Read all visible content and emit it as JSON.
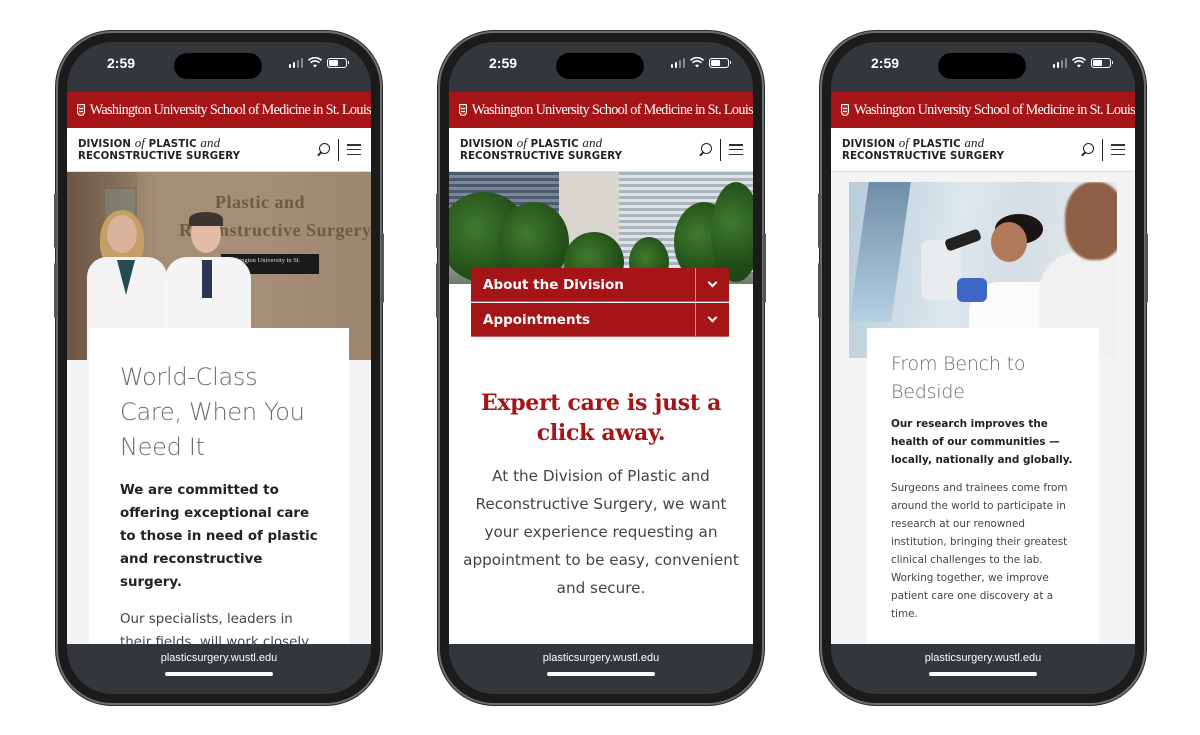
{
  "common": {
    "time": "2:59",
    "university_name": "Washington University School of Medicine in St. Louis",
    "division_line1_a": "DIVISION ",
    "division_line1_of": "of",
    "division_line1_b": " PLASTIC ",
    "division_line1_and": "and",
    "division_line2": "RECONSTRUCTIVE SURGERY",
    "url": "plasticsurgery.wustl.edu",
    "icons": [
      "search-icon",
      "menu-icon",
      "signal-icon",
      "wifi-icon",
      "battery-icon",
      "wustl-shield-icon"
    ],
    "brand_color": "#a51417"
  },
  "phone1": {
    "hero_sign_line1": "Plastic and",
    "hero_sign_line2": "Reconstructive Surgery",
    "hero_plaque": "Washington University in St. Louis",
    "heading": "World-Class Care, When You Need It",
    "lead": "We are committed to offering exceptional care to those in need of plastic and reconstructive surgery.",
    "body": "Our specialists, leaders in their fields, will work closely with all those involved in your health care to ensure a"
  },
  "phone2": {
    "accordion": [
      {
        "label": "About the Division"
      },
      {
        "label": "Appointments"
      }
    ],
    "cta_title": "Expert care is just a click away.",
    "cta_body": "At the Division of Plastic and Reconstructive Surgery, we want your experience requesting an appointment to be easy, convenient and secure."
  },
  "phone3": {
    "heading": "From Bench to Bedside",
    "lead": "Our research improves the health of our communities — locally, nationally and globally.",
    "body": "Surgeons and trainees come from around the world to participate in research at our renowned institution, bringing their greatest clinical challenges to the lab. Working together, we improve patient care one discovery at a time."
  }
}
